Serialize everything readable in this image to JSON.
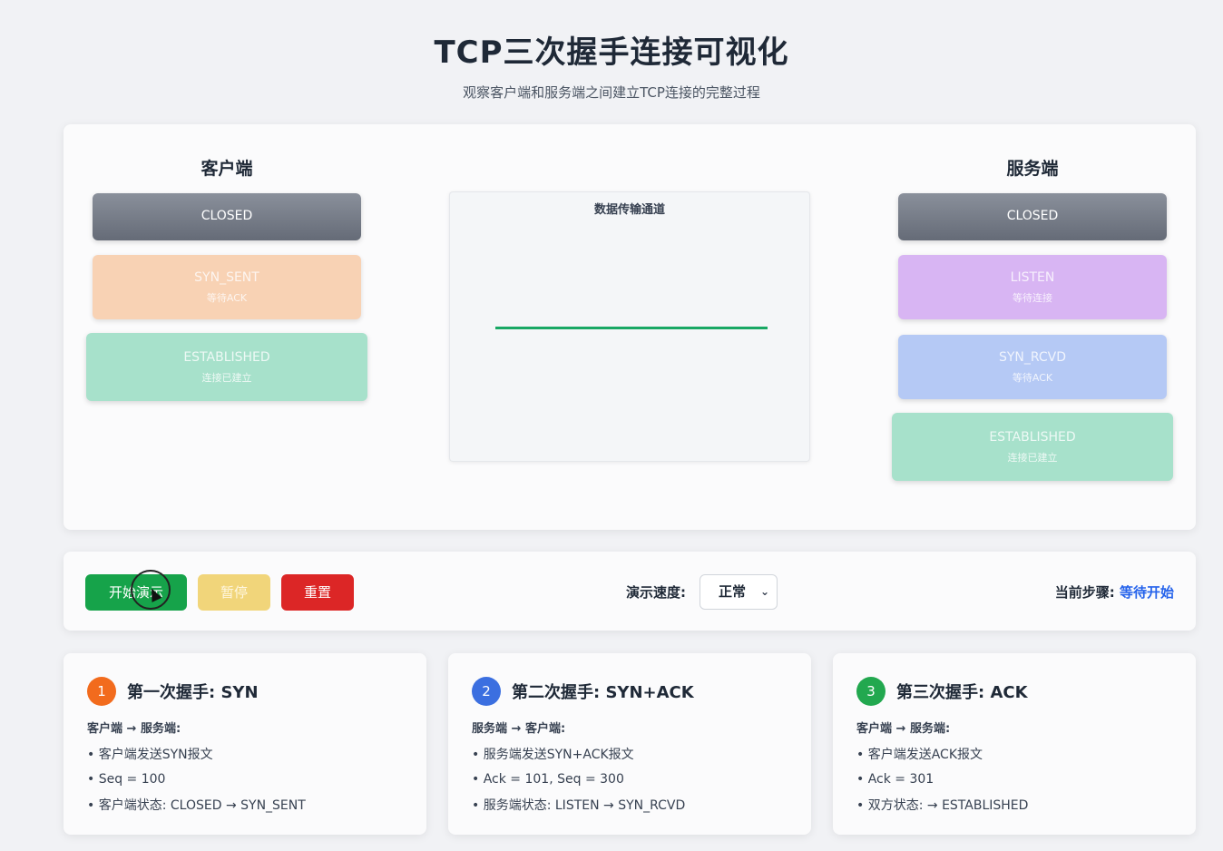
{
  "header": {
    "title": "TCP三次握手连接可视化",
    "subtitle": "观察客户端和服务端之间建立TCP连接的完整过程"
  },
  "client": {
    "title": "客户端",
    "states": [
      {
        "name": "CLOSED",
        "desc": ""
      },
      {
        "name": "SYN_SENT",
        "desc": "等待ACK"
      },
      {
        "name": "ESTABLISHED",
        "desc": "连接已建立"
      }
    ]
  },
  "server": {
    "title": "服务端",
    "states": [
      {
        "name": "CLOSED",
        "desc": ""
      },
      {
        "name": "LISTEN",
        "desc": "等待连接"
      },
      {
        "name": "SYN_RCVD",
        "desc": "等待ACK"
      },
      {
        "name": "ESTABLISHED",
        "desc": "连接已建立"
      }
    ]
  },
  "channel": {
    "title": "数据传输通道"
  },
  "controls": {
    "start_label": "开始演示",
    "pause_label": "暂停",
    "reset_label": "重置",
    "speed_label": "演示速度:",
    "speed_value": "正常",
    "step_label": "当前步骤:",
    "step_value": "等待开始"
  },
  "cards": [
    {
      "num": "1",
      "title": "第一次握手: SYN",
      "direction": "客户端 → 服务端:",
      "lines": [
        "客户端发送SYN报文",
        "Seq = 100",
        "客户端状态: CLOSED → SYN_SENT"
      ]
    },
    {
      "num": "2",
      "title": "第二次握手: SYN+ACK",
      "direction": "服务端 → 客户端:",
      "lines": [
        "服务端发送SYN+ACK报文",
        "Ack = 101, Seq = 300",
        "服务端状态: LISTEN → SYN_RCVD"
      ]
    },
    {
      "num": "3",
      "title": "第三次握手: ACK",
      "direction": "客户端 → 服务端:",
      "lines": [
        "客户端发送ACK报文",
        "Ack = 301",
        "双方状态: → ESTABLISHED"
      ]
    }
  ],
  "colors": {
    "accent_green": "#16a34a",
    "accent_blue": "#2563eb",
    "danger_red": "#dc2626"
  }
}
